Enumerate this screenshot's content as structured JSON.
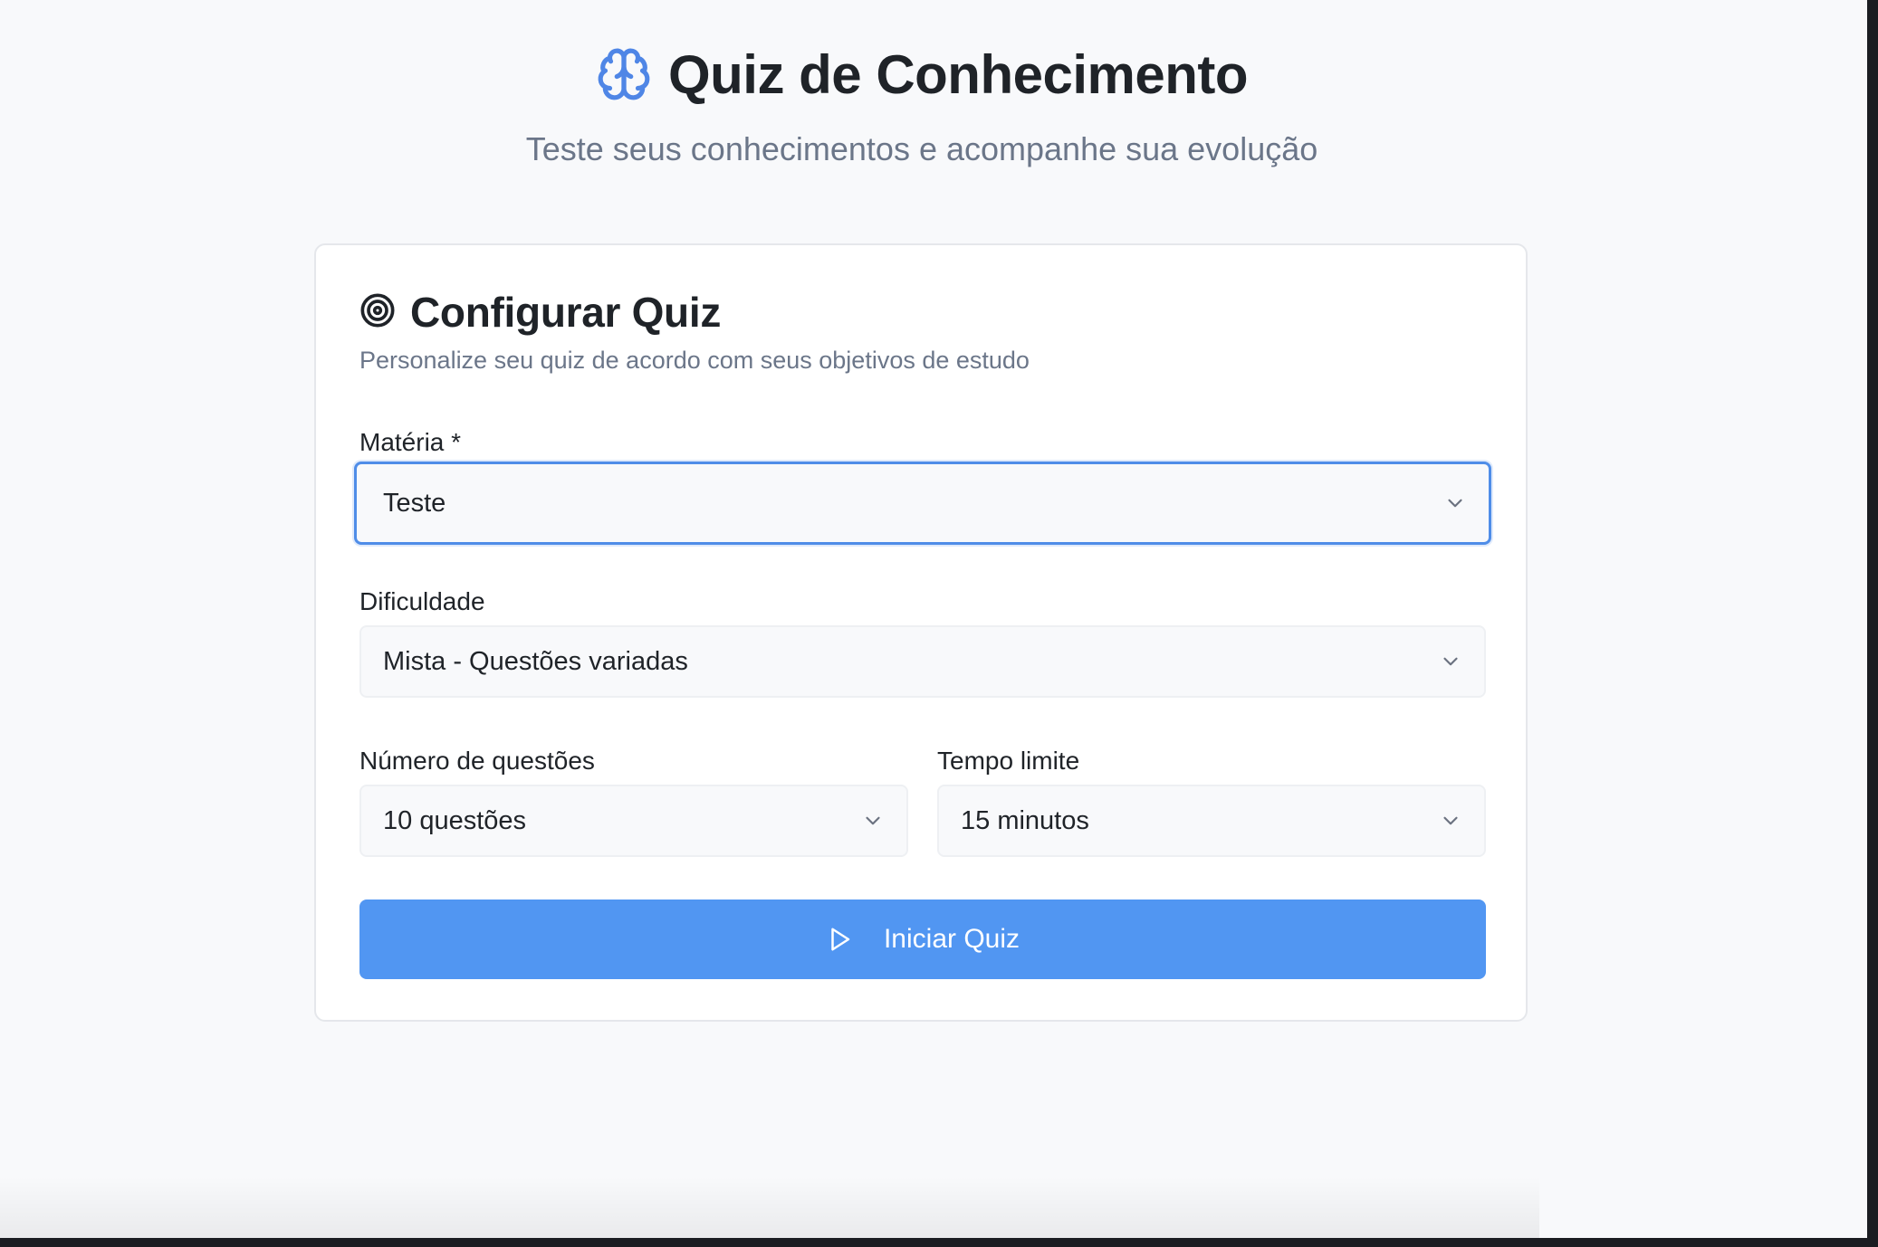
{
  "header": {
    "title": "Quiz de Conhecimento",
    "subtitle": "Teste seus conhecimentos e acompanhe sua evolução",
    "icon": "brain-icon"
  },
  "card": {
    "title": "Configurar Quiz",
    "description": "Personalize seu quiz de acordo com seus objetivos de estudo",
    "icon": "target-icon"
  },
  "form": {
    "subject": {
      "label": "Matéria *",
      "value": "Teste"
    },
    "difficulty": {
      "label": "Dificuldade",
      "value": "Mista - Questões variadas"
    },
    "question_count": {
      "label": "Número de questões",
      "value": "10 questões"
    },
    "time_limit": {
      "label": "Tempo limite",
      "value": "15 minutos"
    },
    "start_button": {
      "label": "Iniciar Quiz",
      "icon": "play-icon"
    }
  },
  "colors": {
    "accent": "#5196f2",
    "focus_border": "#4f8de8",
    "brain_icon": "#4f86e6",
    "background": "#f8f9fb",
    "muted_text": "#6b7689"
  }
}
